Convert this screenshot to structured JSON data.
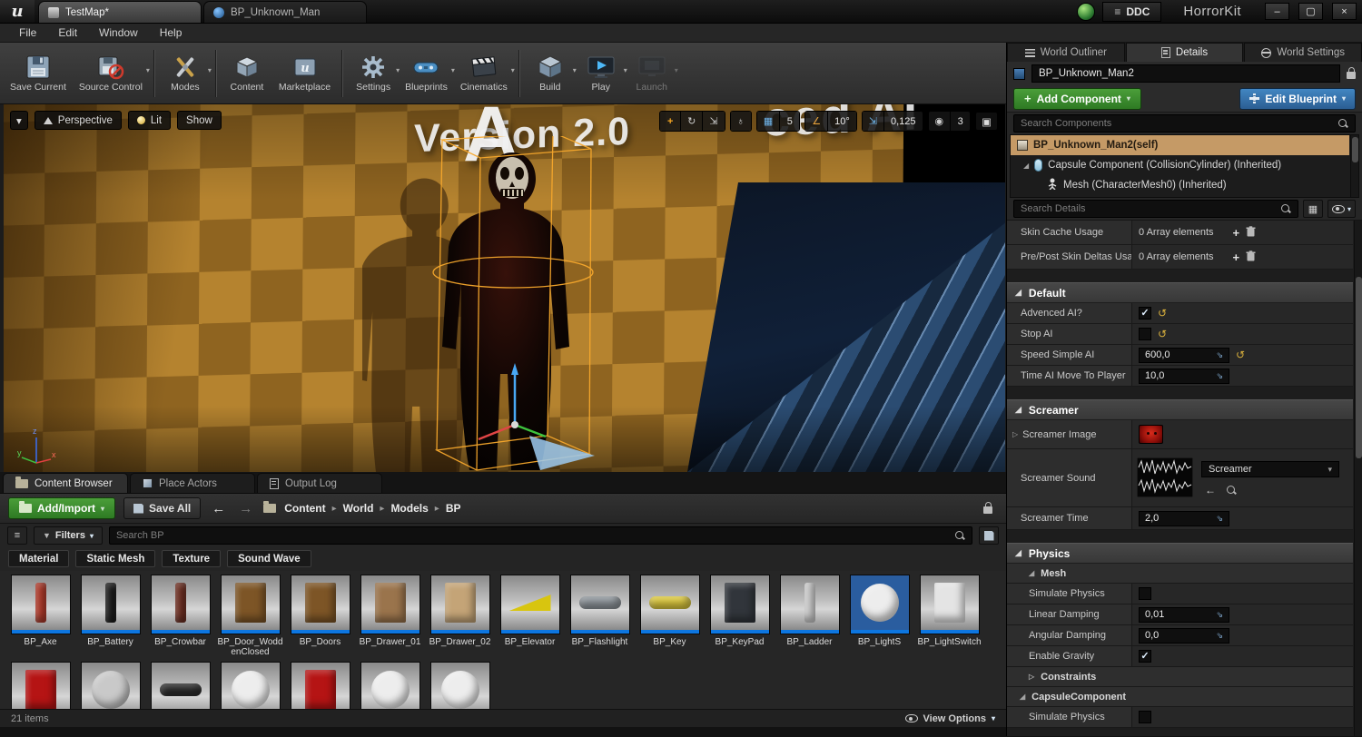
{
  "colors": {
    "accent-green": "#4b9e3a",
    "accent-blue": "#3a7ab5",
    "selection-tan": "#c59a66",
    "blueprint-blue": "#0d76e0",
    "reset-yellow": "#d9b03c",
    "check-blue": "#dfefff"
  },
  "icons": {
    "dropdown": "▾",
    "chevron_right": "▸",
    "expanded": "◢",
    "collapsed": "▷",
    "check": "✓",
    "plus": "+",
    "back_arrow": "←",
    "fwd_arrow": "→",
    "minimize": "–",
    "restore": "▢",
    "close": "×",
    "menu_lines": "≡",
    "move_tool": "+",
    "rotate_tool": "↻",
    "scale_tool": "⇲",
    "globe": "♁",
    "grid": "▦",
    "angle": "∠",
    "camera": "◉",
    "maximize": "▣",
    "funnel": "▼",
    "reset": "↺",
    "spin": "⇘"
  },
  "titlebar": {
    "tabs": [
      {
        "label": "TestMap*"
      },
      {
        "label": "BP_Unknown_Man"
      }
    ],
    "ddc_label": "DDC",
    "project_title": "HorrorKit"
  },
  "menubar": {
    "items": [
      "File",
      "Edit",
      "Window",
      "Help"
    ]
  },
  "toolbar": {
    "items": [
      {
        "label": "Save Current"
      },
      {
        "label": "Source Control"
      },
      {
        "label": "Modes"
      },
      {
        "label": "Content"
      },
      {
        "label": "Marketplace"
      },
      {
        "label": "Settings"
      },
      {
        "label": "Blueprints"
      },
      {
        "label": "Cinematics"
      },
      {
        "label": "Build"
      },
      {
        "label": "Play"
      },
      {
        "label": "Launch"
      }
    ]
  },
  "viewport": {
    "perspective_label": "Perspective",
    "lit_label": "Lit",
    "show_label": "Show",
    "watermark": "Version 2.0",
    "watermark_letter": "A",
    "watermark_right": "ced AI",
    "snap": {
      "grid": "5",
      "rotation": "10°",
      "scale": "0,125",
      "camera": "3"
    },
    "axis": {
      "x": "x",
      "y": "y",
      "z": "z"
    }
  },
  "panel_tabs": {
    "content_browser": "Content Browser",
    "place_actors": "Place Actors",
    "output_log": "Output Log"
  },
  "content_browser": {
    "add_import_label": "Add/Import",
    "save_all_label": "Save All",
    "breadcrumb": [
      "Content",
      "World",
      "Models",
      "BP"
    ],
    "filters_label": "Filters",
    "search_placeholder": "Search BP",
    "chips": [
      "Material",
      "Static Mesh",
      "Texture",
      "Sound Wave"
    ],
    "assets": [
      {
        "name": "BP_Axe",
        "color": "#b03a2a",
        "shape": "tall"
      },
      {
        "name": "BP_Battery",
        "color": "#1c1c1c",
        "shape": "tall"
      },
      {
        "name": "BP_Crowbar",
        "color": "#6e2f22",
        "shape": "tall"
      },
      {
        "name": "BP_Door_WoddenClosed",
        "color": "#7d5526",
        "shape": "box"
      },
      {
        "name": "BP_Doors",
        "color": "#7d5526",
        "shape": "box"
      },
      {
        "name": "BP_Drawer_01",
        "color": "#9a744c",
        "shape": "box"
      },
      {
        "name": "BP_Drawer_02",
        "color": "#c4a477",
        "shape": "box"
      },
      {
        "name": "BP_Elevator",
        "color": "#d8c50f",
        "shape": "wedge"
      },
      {
        "name": "BP_Flashlight",
        "color": "#8f969c",
        "shape": "wide"
      },
      {
        "name": "BP_Key",
        "color": "#ddc93e",
        "shape": "wide"
      },
      {
        "name": "BP_KeyPad",
        "color": "#31353b",
        "shape": "box"
      },
      {
        "name": "BP_Ladder",
        "color": "#cfcfcf",
        "shape": "tall"
      },
      {
        "name": "BP_LightS",
        "color": "#ededed",
        "shape": "circle",
        "bg": "#2a5d9f"
      },
      {
        "name": "BP_LightSwitch",
        "color": "#e4e4e4",
        "shape": "box"
      }
    ],
    "assets_row2": [
      {
        "color": "#b51414",
        "shape": "box"
      },
      {
        "color": "#c9c9c9",
        "shape": "circle"
      },
      {
        "color": "#2e2e2e",
        "shape": "wide"
      },
      {
        "color": "#ededed",
        "shape": "circle"
      },
      {
        "color": "#b51414",
        "shape": "box"
      },
      {
        "color": "#ededed",
        "shape": "circle"
      },
      {
        "color": "#ededed",
        "shape": "circle"
      }
    ],
    "items_count": "21 items",
    "view_options_label": "View Options"
  },
  "details": {
    "tabs": [
      "World Outliner",
      "Details",
      "World Settings"
    ],
    "instance_name": "BP_Unknown_Man2",
    "add_component_label": "Add Component",
    "edit_blueprint_label": "Edit Blueprint",
    "search_components_placeholder": "Search Components",
    "components": [
      {
        "label": "BP_Unknown_Man2(self)"
      },
      {
        "label": "Capsule Component (CollisionCylinder) (Inherited)"
      },
      {
        "label": "Mesh (CharacterMesh0) (Inherited)"
      }
    ],
    "search_details_placeholder": "Search Details",
    "props": {
      "skin_cache": {
        "label": "Skin Cache Usage",
        "value": "0 Array elements"
      },
      "pre_post": {
        "label": "Pre/Post Skin Deltas Usa",
        "value": "0 Array elements"
      },
      "section_default": "Default",
      "advanced_ai": {
        "label": "Advenced AI?",
        "checked": true
      },
      "stop_ai": {
        "label": "Stop AI",
        "checked": false
      },
      "speed_simple_ai": {
        "label": "Speed Simple AI",
        "value": "600,0"
      },
      "time_ai_move": {
        "label": "Time AI Move To Player",
        "value": "10,0"
      },
      "section_screamer": "Screamer",
      "screamer_image": {
        "label": "Screamer Image"
      },
      "screamer_sound": {
        "label": "Screamer Sound",
        "value": "Screamer"
      },
      "screamer_time": {
        "label": "Screamer Time",
        "value": "2,0"
      },
      "section_physics": "Physics",
      "sub_mesh": "Mesh",
      "simulate_physics": {
        "label": "Simulate Physics",
        "checked": false
      },
      "linear_damping": {
        "label": "Linear Damping",
        "value": "0,01"
      },
      "angular_damping": {
        "label": "Angular Damping",
        "value": "0,0"
      },
      "enable_gravity": {
        "label": "Enable Gravity",
        "checked": true
      },
      "sub_constraints": "Constraints",
      "sub_capsule": "CapsuleComponent",
      "simulate_physics2": {
        "label": "Simulate Physics",
        "checked": false
      }
    }
  }
}
